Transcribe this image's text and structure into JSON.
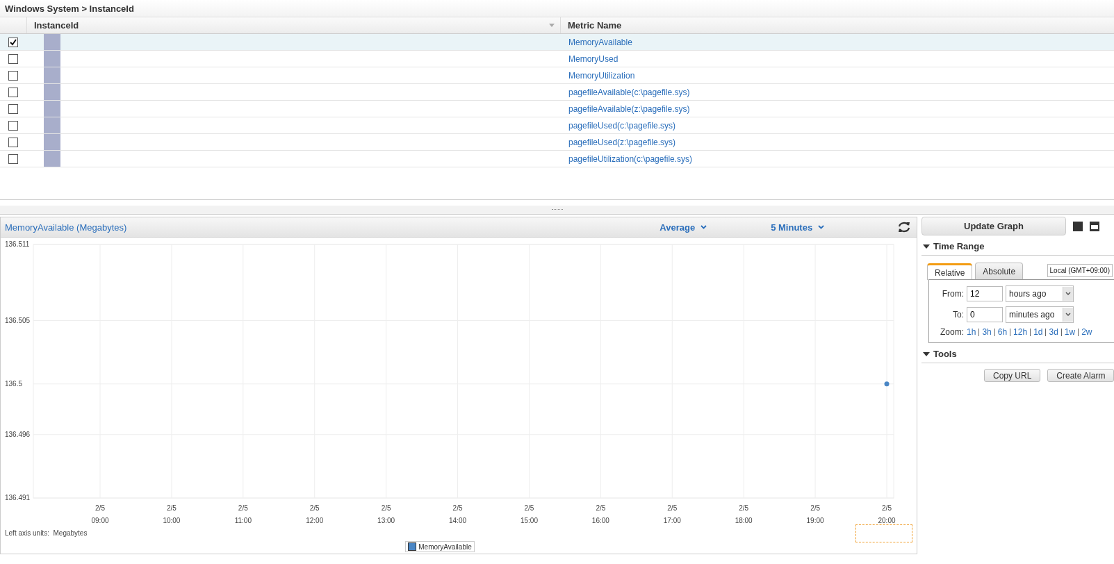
{
  "breadcrumb": "Windows System > InstanceId",
  "table": {
    "columns": [
      "InstanceId",
      "Metric Name"
    ],
    "rows": [
      {
        "checked": true,
        "selected": true,
        "metric": "MemoryAvailable"
      },
      {
        "checked": false,
        "selected": false,
        "metric": "MemoryUsed"
      },
      {
        "checked": false,
        "selected": false,
        "metric": "MemoryUtilization"
      },
      {
        "checked": false,
        "selected": false,
        "metric": "pagefileAvailable(c:\\pagefile.sys)"
      },
      {
        "checked": false,
        "selected": false,
        "metric": "pagefileAvailable(z:\\pagefile.sys)"
      },
      {
        "checked": false,
        "selected": false,
        "metric": "pagefileUsed(c:\\pagefile.sys)"
      },
      {
        "checked": false,
        "selected": false,
        "metric": "pagefileUsed(z:\\pagefile.sys)"
      },
      {
        "checked": false,
        "selected": false,
        "metric": "pagefileUtilization(c:\\pagefile.sys)"
      }
    ]
  },
  "graph": {
    "title": "MemoryAvailable (Megabytes)",
    "statistic": "Average",
    "period": "5 Minutes",
    "units_label": "Left axis units:",
    "units": "Megabytes",
    "chart_data": {
      "type": "line",
      "grid": true,
      "categories": [
        "2/5 09:00",
        "2/5 10:00",
        "2/5 11:00",
        "2/5 12:00",
        "2/5 13:00",
        "2/5 14:00",
        "2/5 15:00",
        "2/5 16:00",
        "2/5 17:00",
        "2/5 18:00",
        "2/5 19:00",
        "2/5 20:00"
      ],
      "ylim": [
        136.491,
        136.511
      ],
      "yticks": [
        136.491,
        136.496,
        136.5,
        136.505,
        136.511
      ],
      "series": [
        {
          "name": "MemoryAvailable",
          "color": "#4a86c5",
          "marker": "circle",
          "values": [
            null,
            null,
            null,
            null,
            null,
            null,
            null,
            null,
            null,
            null,
            null,
            136.5
          ]
        }
      ]
    }
  },
  "side": {
    "update_button": "Update Graph",
    "time_range": {
      "title": "Time Range",
      "expanded": true,
      "tabs": [
        {
          "label": "Relative",
          "selected": true
        },
        {
          "label": "Absolute",
          "selected": false
        }
      ],
      "timezone": "Local (GMT+09:00)",
      "from_label": "From:",
      "from_value": "12",
      "from_unit": "hours ago",
      "to_label": "To:",
      "to_value": "0",
      "to_unit": "minutes ago",
      "zoom_label": "Zoom:",
      "zoom_links": [
        "1h",
        "3h",
        "6h",
        "12h",
        "1d",
        "3d",
        "1w",
        "2w"
      ]
    },
    "tools": {
      "title": "Tools",
      "expanded": true,
      "buttons": [
        "Copy URL",
        "Create Alarm"
      ]
    }
  }
}
